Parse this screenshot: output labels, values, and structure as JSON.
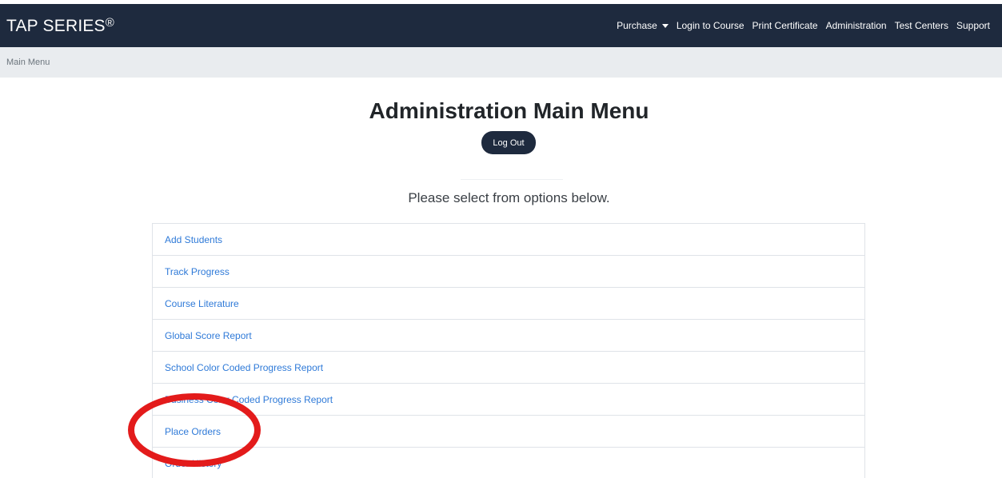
{
  "navbar": {
    "brand": "TAP SERIES",
    "brand_mark": "®",
    "links": [
      {
        "label": "Purchase",
        "has_dropdown": true,
        "icon": "caret-down-icon"
      },
      {
        "label": "Login to Course"
      },
      {
        "label": "Print Certificate"
      },
      {
        "label": "Administration"
      },
      {
        "label": "Test Centers"
      },
      {
        "label": "Support"
      }
    ],
    "background": "#1e2a3e"
  },
  "breadcrumb": {
    "current": "Main Menu"
  },
  "main": {
    "title": "Administration Main Menu",
    "logout_label": "Log Out",
    "subtitle": "Please select from options below.",
    "menu_items": [
      {
        "label": "Add Students"
      },
      {
        "label": "Track Progress"
      },
      {
        "label": "Course Literature"
      },
      {
        "label": "Global Score Report"
      },
      {
        "label": "School Color Coded Progress Report"
      },
      {
        "label": "Business Color Coded Progress Report"
      },
      {
        "label": "Place Orders"
      },
      {
        "label": "Order History"
      }
    ]
  },
  "annotation": {
    "highlighted_item": "Place Orders",
    "color": "#e31b1b"
  },
  "colors": {
    "link": "#2f7ad8",
    "breadcrumb_bg": "#e9ecef",
    "button_bg": "#1e2a3e"
  }
}
